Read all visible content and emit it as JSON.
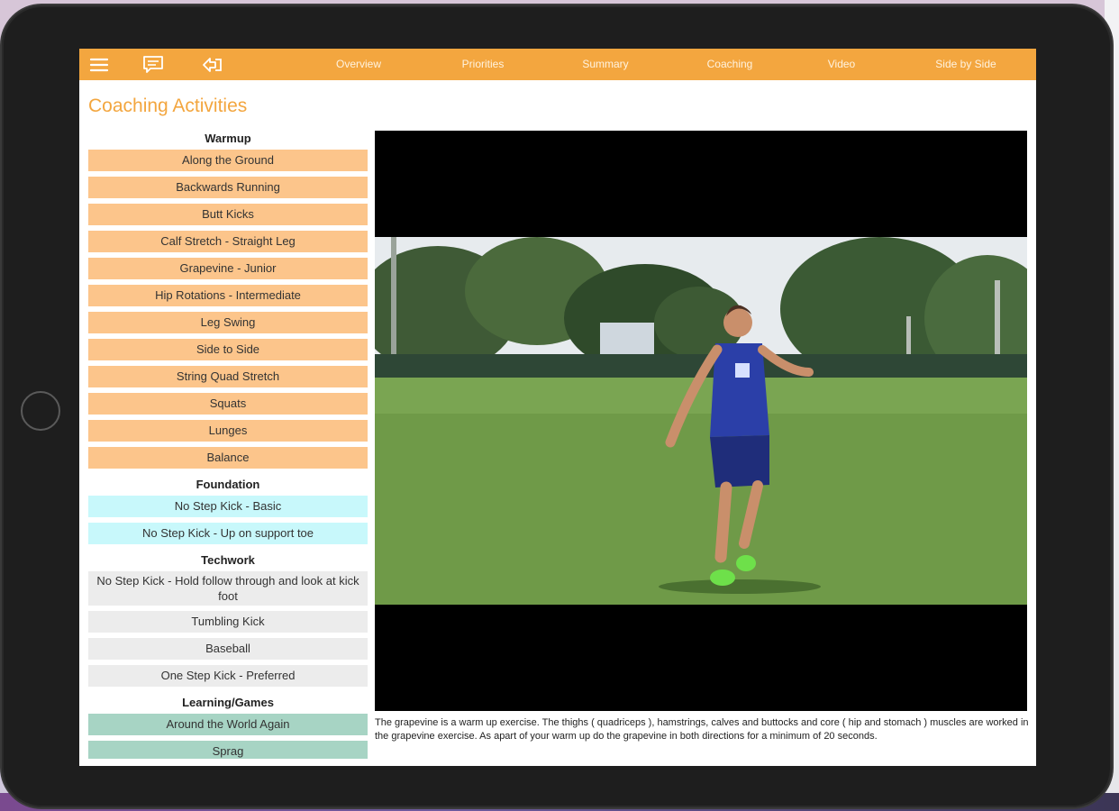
{
  "toolbar": {
    "icons": [
      "menu-icon",
      "chat-icon",
      "exit-icon"
    ],
    "tabs": [
      {
        "label": "Overview"
      },
      {
        "label": "Priorities"
      },
      {
        "label": "Summary"
      },
      {
        "label": "Coaching"
      },
      {
        "label": "Video"
      },
      {
        "label": "Side by Side"
      }
    ]
  },
  "page": {
    "title": "Coaching Activities"
  },
  "sections": {
    "warmup": {
      "title": "Warmup",
      "items": [
        "Along the Ground",
        "Backwards Running",
        "Butt Kicks",
        "Calf Stretch - Straight Leg",
        "Grapevine - Junior",
        "Hip Rotations - Intermediate",
        "Leg Swing",
        "Side to Side",
        "String Quad Stretch",
        "Squats",
        "Lunges",
        "Balance"
      ]
    },
    "foundation": {
      "title": "Foundation",
      "items": [
        "No Step Kick - Basic",
        "No Step Kick - Up on support toe"
      ]
    },
    "techwork": {
      "title": "Techwork",
      "items": [
        "No Step Kick - Hold follow through and look at kick foot",
        "Tumbling Kick",
        "Baseball",
        "One Step Kick - Preferred"
      ]
    },
    "learning": {
      "title": "Learning/Games",
      "items": [
        "Around the World Again",
        "Sprag"
      ]
    }
  },
  "colors": {
    "accent": "#f3a63f",
    "warmup_item": "#fcc58b",
    "foundation_item": "#c8f8fb",
    "techwork_item": "#ececec",
    "learning_item": "#a7d4c4"
  },
  "video": {
    "description": "The grapevine is a warm up exercise. The thighs ( quadriceps ), hamstrings, calves and buttocks and core ( hip and stomach ) muscles are worked in the grapevine exercise. As apart of your warm up do the grapevine in both directions for a minimum of 20 seconds."
  }
}
